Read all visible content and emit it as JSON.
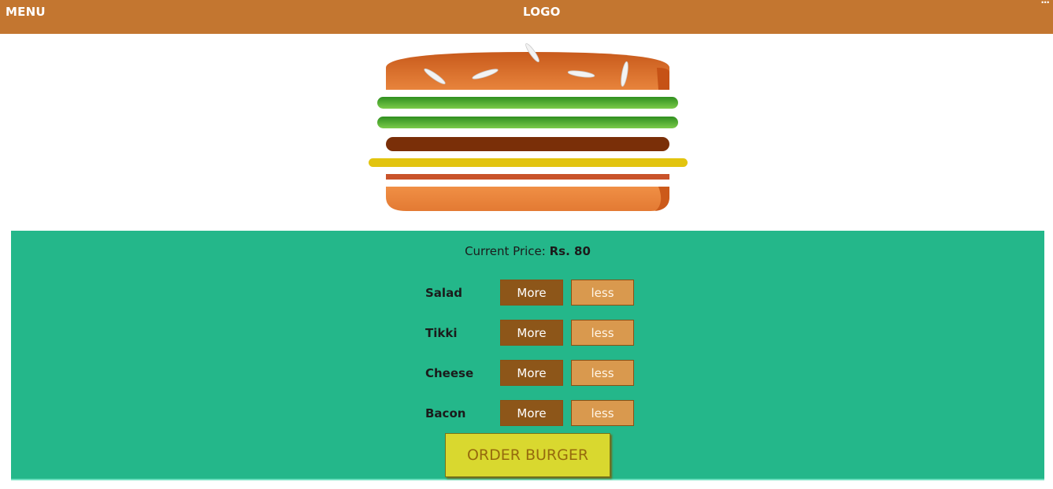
{
  "header": {
    "menu_label": "MENU",
    "logo_label": "LOGO",
    "corner_glyph": "..."
  },
  "builder": {
    "price_prefix": "Current Price:",
    "price_value": "Rs. 80",
    "ingredients": [
      {
        "label": "Salad",
        "more_label": "More",
        "less_label": "less"
      },
      {
        "label": "Tikki",
        "more_label": "More",
        "less_label": "less"
      },
      {
        "label": "Cheese",
        "more_label": "More",
        "less_label": "less"
      },
      {
        "label": "Bacon",
        "more_label": "More",
        "less_label": "less"
      }
    ],
    "order_label": "ORDER BURGER"
  },
  "colors": {
    "header_bg": "#c37630",
    "panel_bg": "#24b78a",
    "more_btn": "#8d5619",
    "less_btn": "#d9994e",
    "order_btn": "#d9d82f",
    "salad": "#4caf2f",
    "tikki": "#7a2f08",
    "cheese": "#e2c40f",
    "bacon": "#c9532a",
    "bun": "#e07b35"
  },
  "burger_layers": [
    "salad",
    "salad",
    "tikki",
    "cheese",
    "bacon"
  ]
}
